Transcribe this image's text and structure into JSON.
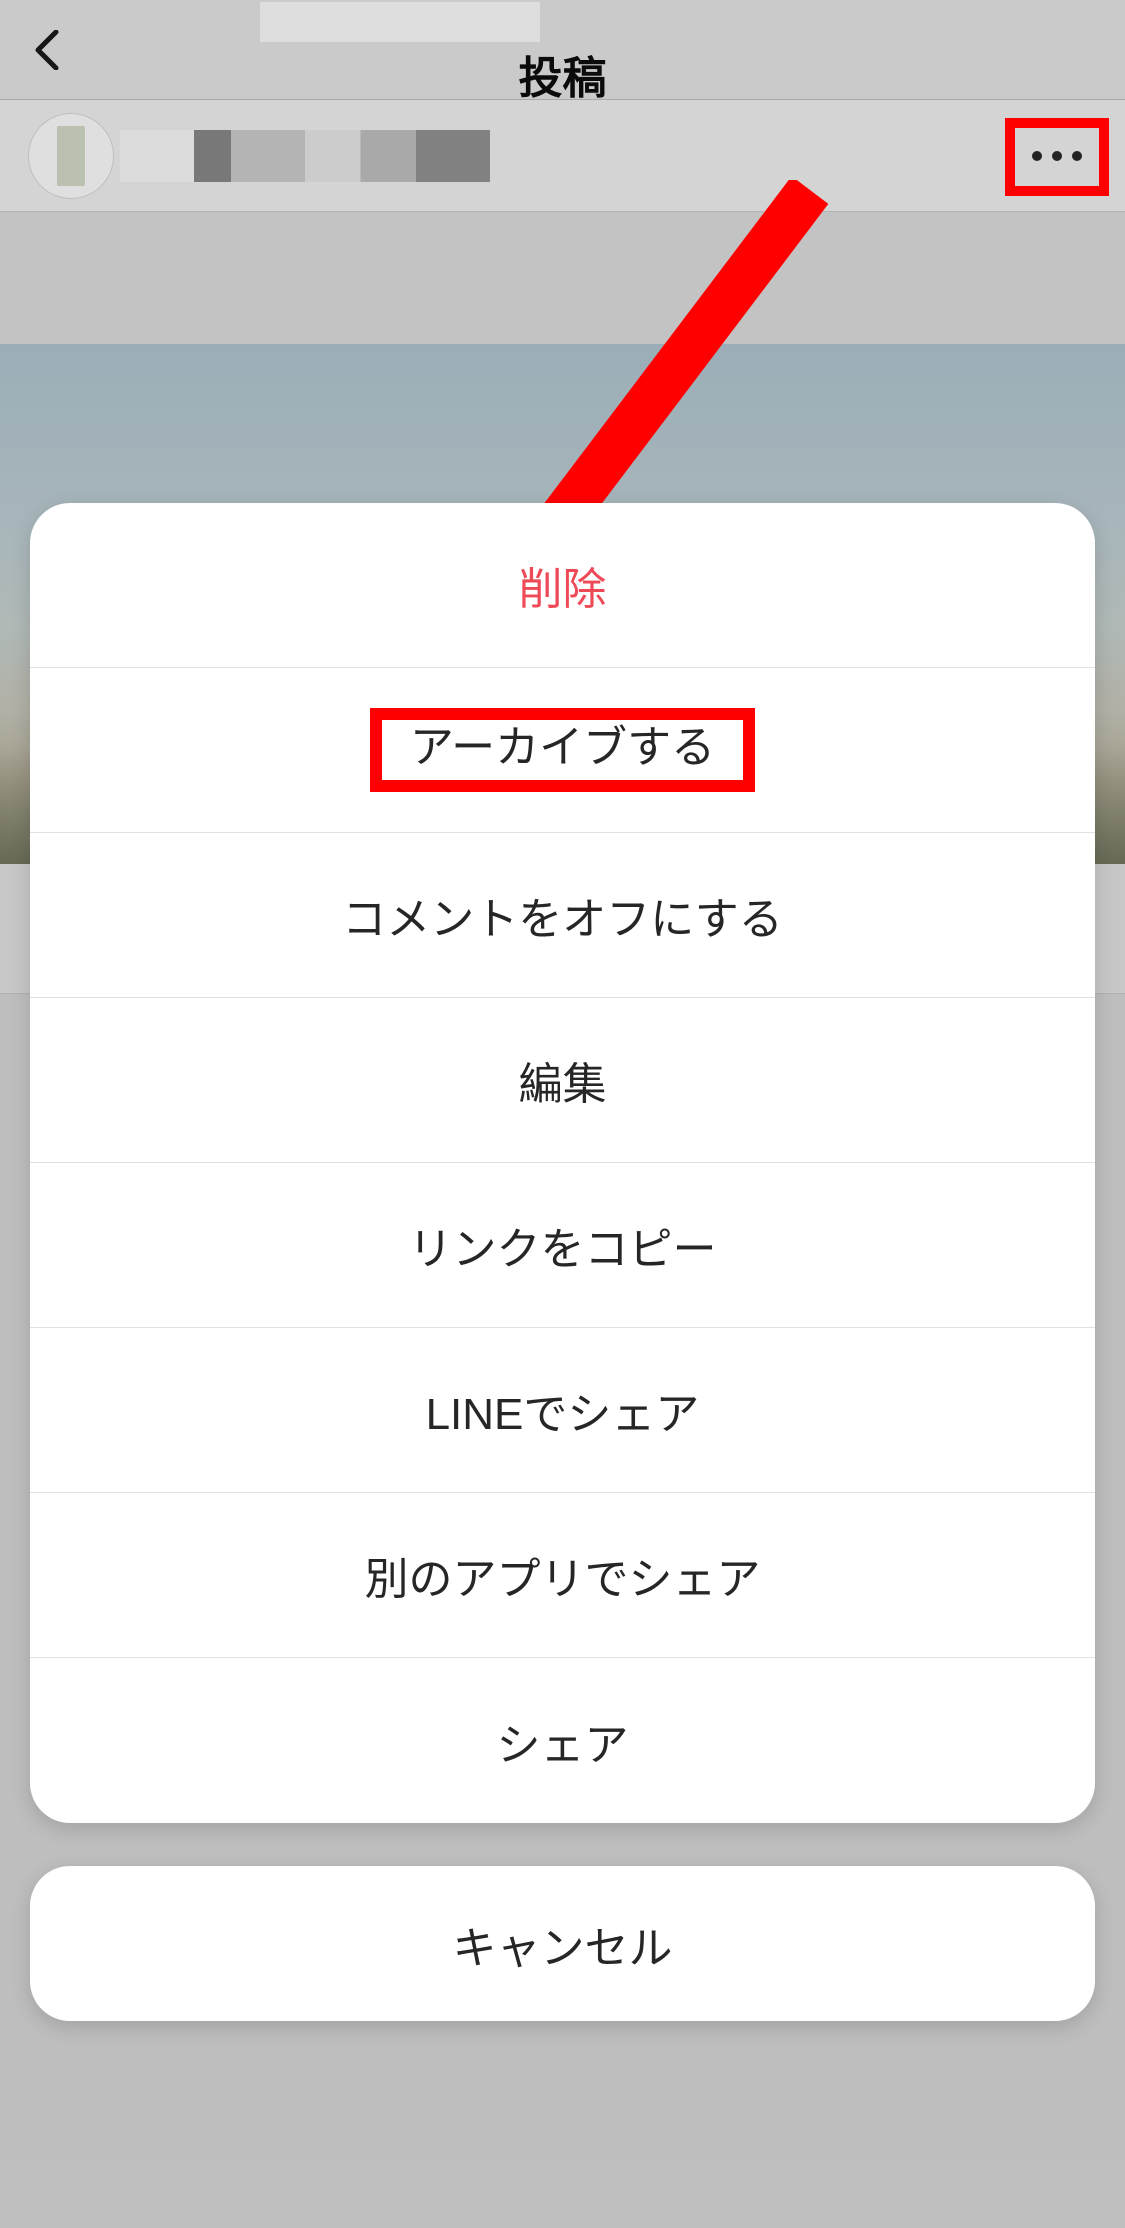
{
  "header": {
    "title": "投稿"
  },
  "annotations": {
    "highlight_color": "#ff0000"
  },
  "action_sheet": {
    "items": {
      "delete": "削除",
      "archive": "アーカイブする",
      "turn_off_comments": "コメントをオフにする",
      "edit": "編集",
      "copy_link": "リンクをコピー",
      "share_line": "LINEでシェア",
      "share_other_app": "別のアプリでシェア",
      "share": "シェア"
    },
    "cancel": "キャンセル"
  }
}
